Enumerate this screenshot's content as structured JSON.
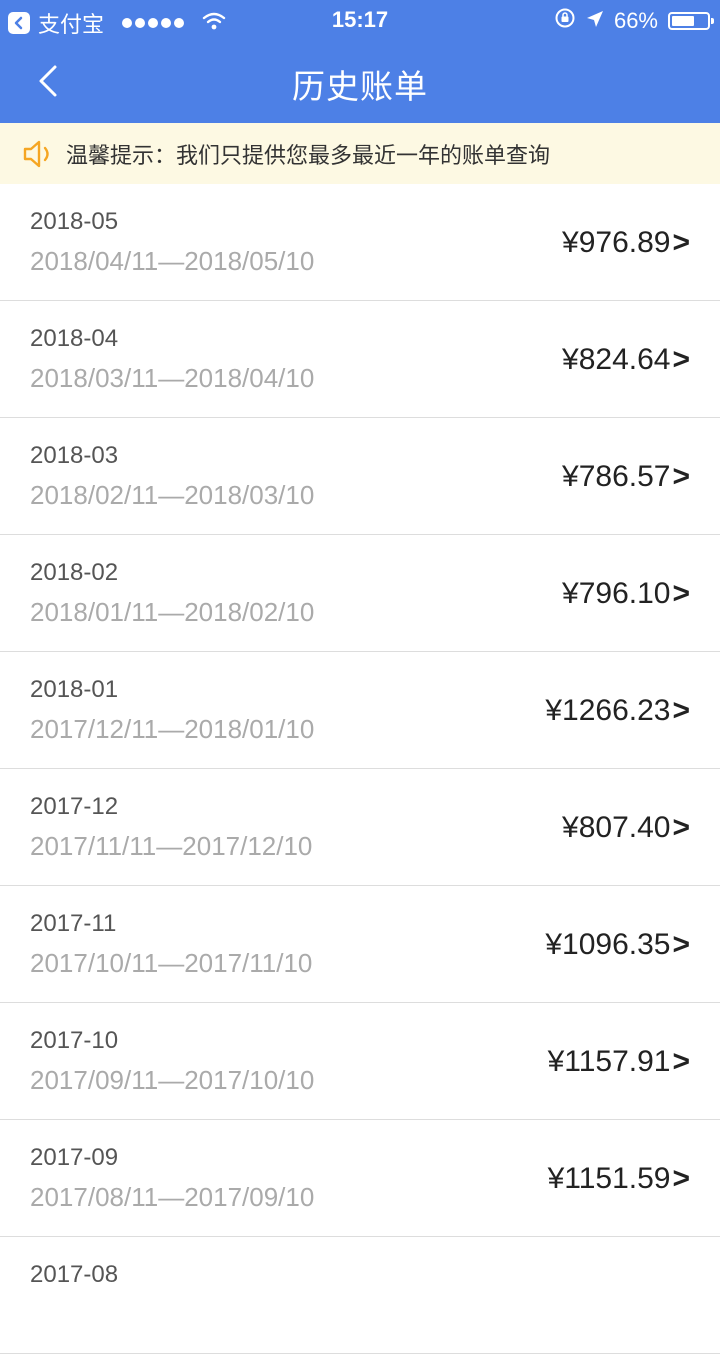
{
  "status_bar": {
    "carrier": "支付宝",
    "time": "15:17",
    "battery": "66%",
    "battery_level": 0.66
  },
  "header": {
    "title": "历史账单"
  },
  "notice": {
    "text": "温馨提示：我们只提供您最多最近一年的账单查询"
  },
  "bills": [
    {
      "month": "2018-05",
      "period": "2018/04/11—2018/05/10",
      "amount": "¥976.89"
    },
    {
      "month": "2018-04",
      "period": "2018/03/11—2018/04/10",
      "amount": "¥824.64"
    },
    {
      "month": "2018-03",
      "period": "2018/02/11—2018/03/10",
      "amount": "¥786.57"
    },
    {
      "month": "2018-02",
      "period": "2018/01/11—2018/02/10",
      "amount": "¥796.10"
    },
    {
      "month": "2018-01",
      "period": "2017/12/11—2018/01/10",
      "amount": "¥1266.23"
    },
    {
      "month": "2017-12",
      "period": "2017/11/11—2017/12/10",
      "amount": "¥807.40"
    },
    {
      "month": "2017-11",
      "period": "2017/10/11—2017/11/10",
      "amount": "¥1096.35"
    },
    {
      "month": "2017-10",
      "period": "2017/09/11—2017/10/10",
      "amount": "¥1157.91"
    },
    {
      "month": "2017-09",
      "period": "2017/08/11—2017/09/10",
      "amount": "¥1151.59"
    },
    {
      "month": "2017-08",
      "period": "",
      "amount": ""
    }
  ],
  "row_arrow": ">",
  "colors": {
    "header_bg": "#4d80e6",
    "notice_bg": "#fdf9e3",
    "notice_icon": "#f5a623"
  }
}
